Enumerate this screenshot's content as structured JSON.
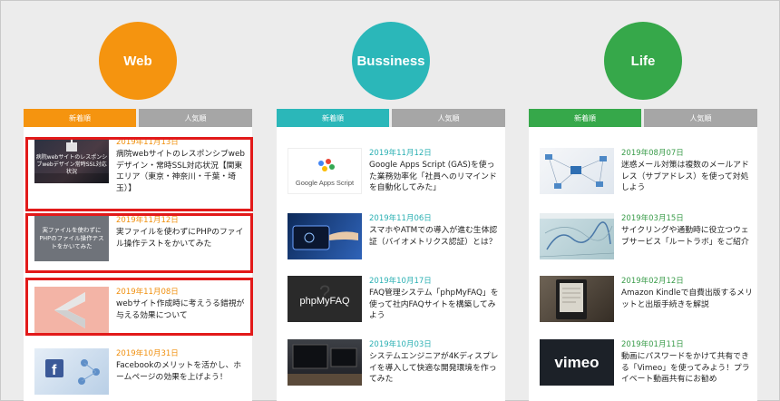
{
  "colors": {
    "web": "#f5940f",
    "business": "#2bb7b9",
    "life": "#36a84a",
    "highlight": "#e21a1a"
  },
  "columns": [
    {
      "id": "web",
      "label": "Web",
      "tabs": {
        "new": "新着順",
        "popular": "人気順"
      },
      "items": [
        {
          "date": "2019年11月13日",
          "title": "病院webサイトのレスポンシブwebデザイン・常時SSL対応状況【関東エリア（東京・神奈川・千葉・埼玉）】",
          "thumb_text": "病院webサイトのレスポンシブwebデザイン常時SSL対応状況"
        },
        {
          "date": "2019年11月12日",
          "title": "実ファイルを使わずにPHPのファイル操作テストをかいてみた",
          "thumb_text": "実ファイルを使わずにPHPのファイル操作テストをかいてみた"
        },
        {
          "date": "2019年11月08日",
          "title": "webサイト作成時に考えうる錯視が与える効果について"
        },
        {
          "date": "2019年10月31日",
          "title": "Facebookのメリットを活かし、ホームページの効果を上げよう！"
        }
      ]
    },
    {
      "id": "business",
      "label": "Bussiness",
      "tabs": {
        "new": "新着順",
        "popular": "人気順"
      },
      "items": [
        {
          "date": "2019年11月12日",
          "title": "Google Apps Script (GAS)を使った業務効率化「社員へのリマインドを自動化してみた」",
          "thumb_text": "Google Apps Script"
        },
        {
          "date": "2019年11月06日",
          "title": "スマホやATMでの導入が進む生体認証（バイオメトリクス認証）とは？"
        },
        {
          "date": "2019年10月17日",
          "title": "FAQ管理システム「phpMyFAQ」を使って社内FAQサイトを構築してみよう",
          "thumb_text": "phpMyFAQ"
        },
        {
          "date": "2019年10月03日",
          "title": "システムエンジニアが4Kディスプレイを導入して快適な開発環境を作ってみた"
        }
      ]
    },
    {
      "id": "life",
      "label": "Life",
      "tabs": {
        "new": "新着順",
        "popular": "人気順"
      },
      "items": [
        {
          "date": "2019年08月07日",
          "title": "迷惑メール対策は複数のメールアドレス（サブアドレス）を使って対処しよう"
        },
        {
          "date": "2019年03月15日",
          "title": "サイクリングや通勤時に役立つウェブサービス「ルートラボ」をご紹介"
        },
        {
          "date": "2019年02月12日",
          "title": "Amazon Kindleで自費出版するメリットと出版手続きを解説"
        },
        {
          "date": "2019年01月11日",
          "title": "動画にパスワードをかけて共有できる「Vimeo」を使ってみよう！プライベート動画共有にお勧め",
          "thumb_text": "vimeo"
        }
      ]
    }
  ]
}
